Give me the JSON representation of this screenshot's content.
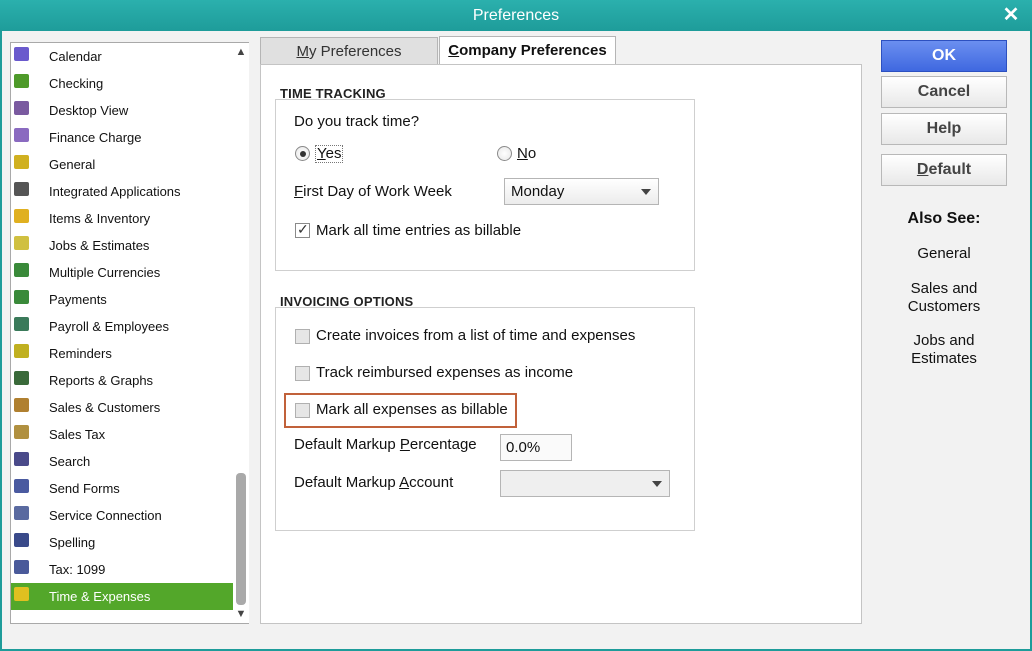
{
  "window": {
    "title": "Preferences",
    "close_glyph": "✕"
  },
  "sidebar": {
    "items": [
      {
        "label": "Calendar",
        "icon": "calendar-icon",
        "color": "#6a5acd"
      },
      {
        "label": "Checking",
        "icon": "checking-icon",
        "color": "#4e9a2a"
      },
      {
        "label": "Desktop View",
        "icon": "desktop-view-icon",
        "color": "#7a5aa0"
      },
      {
        "label": "Finance Charge",
        "icon": "percent-icon",
        "color": "#8a6ac0"
      },
      {
        "label": "General",
        "icon": "general-icon",
        "color": "#d0b020"
      },
      {
        "label": "Integrated Applications",
        "icon": "integrated-apps-icon",
        "color": "#555555"
      },
      {
        "label": "Items & Inventory",
        "icon": "inventory-icon",
        "color": "#e0b020"
      },
      {
        "label": "Jobs & Estimates",
        "icon": "jobs-icon",
        "color": "#d0c040"
      },
      {
        "label": "Multiple Currencies",
        "icon": "currency-icon",
        "color": "#3a8a3a"
      },
      {
        "label": "Payments",
        "icon": "payments-icon",
        "color": "#3a8a3a"
      },
      {
        "label": "Payroll & Employees",
        "icon": "payroll-icon",
        "color": "#3a7a5a"
      },
      {
        "label": "Reminders",
        "icon": "reminders-icon",
        "color": "#c0b020"
      },
      {
        "label": "Reports & Graphs",
        "icon": "reports-icon",
        "color": "#3a6a3a"
      },
      {
        "label": "Sales & Customers",
        "icon": "sales-icon",
        "color": "#b08030"
      },
      {
        "label": "Sales Tax",
        "icon": "sales-tax-icon",
        "color": "#b09040"
      },
      {
        "label": "Search",
        "icon": "search-icon",
        "color": "#4a4a8a"
      },
      {
        "label": "Send Forms",
        "icon": "send-forms-icon",
        "color": "#4a5aa0"
      },
      {
        "label": "Service Connection",
        "icon": "service-connection-icon",
        "color": "#5a6aa0"
      },
      {
        "label": "Spelling",
        "icon": "spelling-icon",
        "color": "#3a4a8a"
      },
      {
        "label": "Tax: 1099",
        "icon": "tax-1099-icon",
        "color": "#4a5a9a"
      },
      {
        "label": "Time & Expenses",
        "icon": "clock-icon",
        "color": "#e0c020",
        "selected": true
      }
    ],
    "scroll_up": "▲",
    "scroll_down": "▼"
  },
  "tabs": {
    "my_prefix": "M",
    "my_rest": "y Preferences",
    "company_prefix": "C",
    "company_rest": "ompany Preferences"
  },
  "time_tracking": {
    "title": "TIME TRACKING",
    "question": "Do you track time?",
    "yes_prefix": "Y",
    "yes_rest": "es",
    "yes_selected": true,
    "no_prefix": "N",
    "no_rest": "o",
    "first_day_prefix": "F",
    "first_day_rest": "irst Day of Work Week",
    "first_day_value": "Monday",
    "mark_time_billable": "Mark all time entries as billable",
    "mark_time_billable_checked": true
  },
  "invoicing": {
    "title": "INVOICING OPTIONS",
    "create_invoices": "Create invoices from a list of time and expenses",
    "track_reimbursed": "Track reimbursed expenses as income",
    "mark_expenses_billable": "Mark all expenses as billable",
    "markup_pct_before": "Default Markup ",
    "markup_pct_u": "P",
    "markup_pct_after": "ercentage",
    "markup_pct_value": "0.0%",
    "markup_acct_before": "Default Markup ",
    "markup_acct_u": "A",
    "markup_acct_after": "ccount",
    "markup_acct_value": ""
  },
  "buttons": {
    "ok": "OK",
    "cancel": "Cancel",
    "help": "Help",
    "default_prefix": "D",
    "default_rest": "efault",
    "ok_color": "#4a72e6"
  },
  "also_see": {
    "title": "Also See:",
    "links": [
      "General",
      "Sales and\nCustomers",
      "Jobs and\nEstimates"
    ],
    "link1": "General",
    "link2a": "Sales and",
    "link2b": "Customers",
    "link3a": "Jobs and",
    "link3b": "Estimates"
  }
}
